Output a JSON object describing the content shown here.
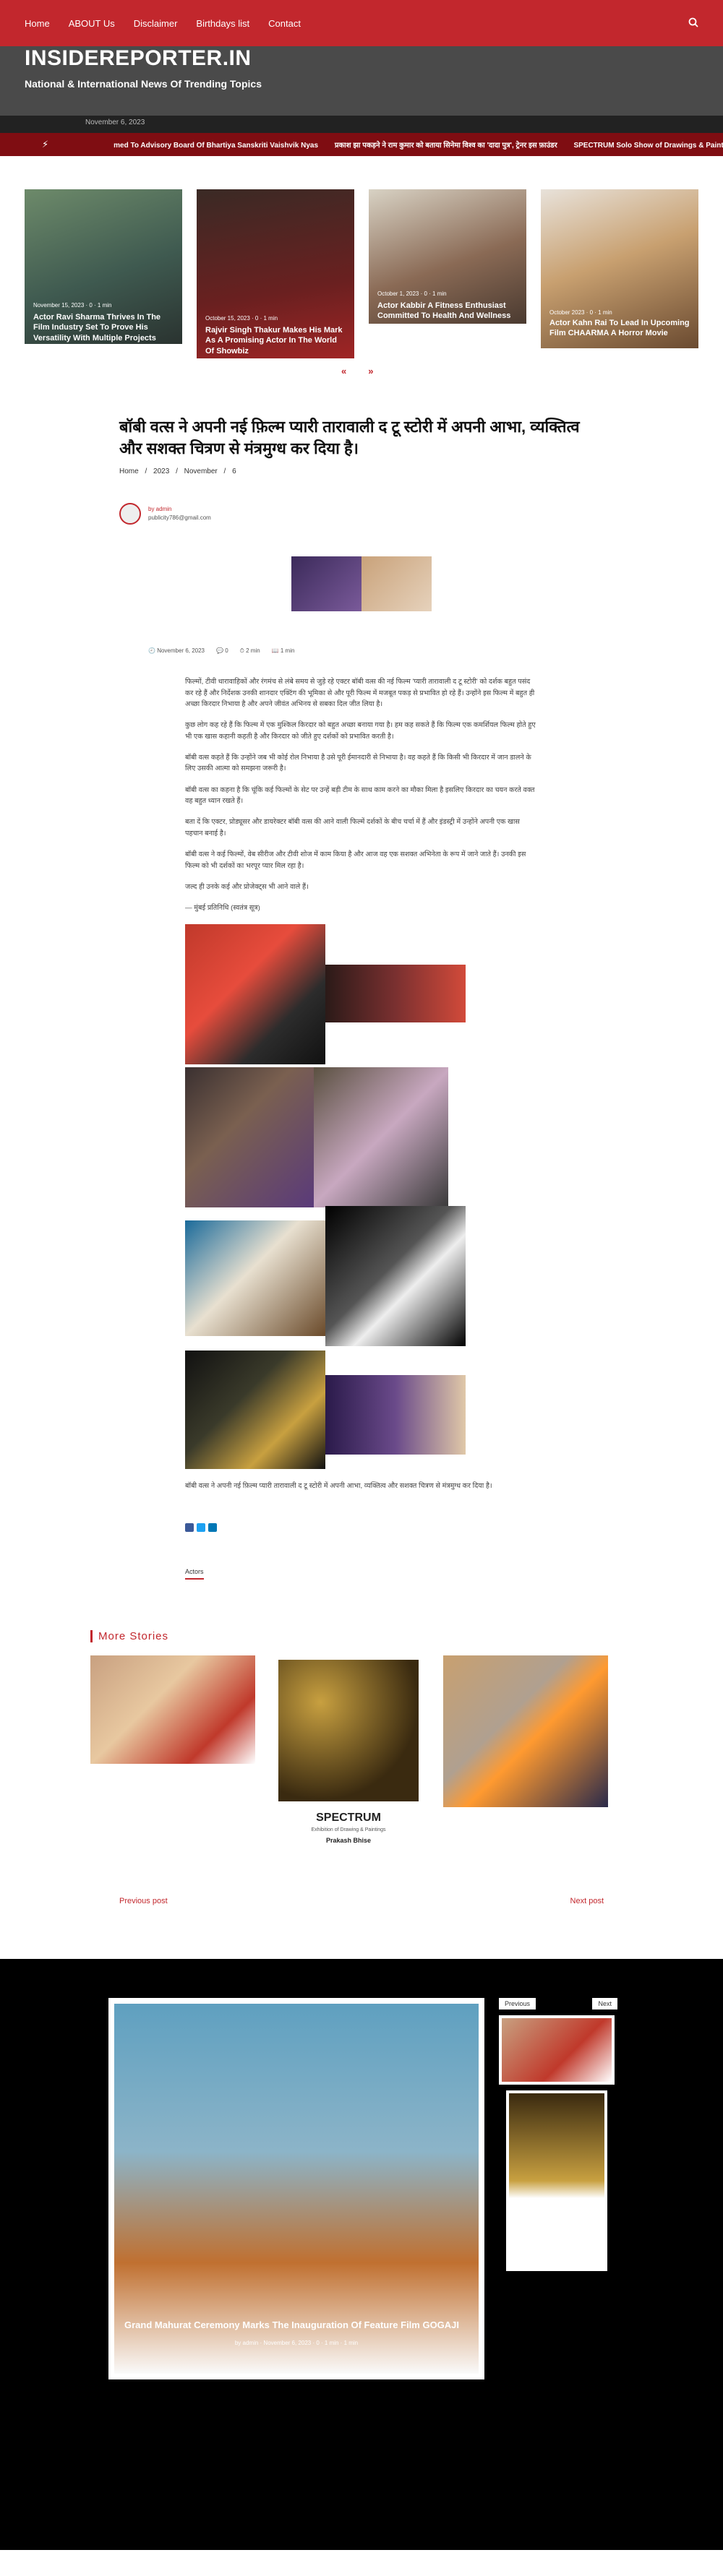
{
  "nav": {
    "items": [
      "Home",
      "ABOUT Us",
      "Disclaimer",
      "Birthdays list",
      "Contact"
    ],
    "search_icon": "search-icon"
  },
  "site": {
    "title": "INSIDEREPORTER.IN",
    "tagline": "National & International News Of Trending Topics"
  },
  "date_strip": "November 6, 2023",
  "ticker": {
    "icon": "lightning-icon",
    "items": [
      "med To Advisory Board Of Bhartiya Sanskriti Vaishvik Nyas",
      "प्रकाश झा पकड़ने ने राम कुमार को बताया सिनेमा विश्व का 'दादा पुत्र', ट्रेनर इस फ़ाउंडर",
      "SPECTRUM Solo Show of Drawings & Paintings by veteran"
    ]
  },
  "slider": {
    "slides": [
      {
        "meta": "November 15, 2023 · 0 · 1 min",
        "caption": "Actor Ravi Sharma Thrives In The Film Industry Set To Prove His Versatility With Multiple Projects"
      },
      {
        "meta": "October 15, 2023 · 0 · 1 min",
        "caption": "Rajvir Singh Thakur Makes His Mark As A Promising Actor In The World Of Showbiz"
      },
      {
        "meta": "October 1, 2023 · 0 · 1 min",
        "caption": "Actor Kabbir A Fitness Enthusiast Committed To Health And Wellness"
      },
      {
        "meta": "October 2023 · 0 · 1 min",
        "caption": "Actor Kahn Rai To Lead In Upcoming Film CHAARMA A Horror Movie"
      }
    ],
    "prev": "«",
    "next": "»"
  },
  "article": {
    "title": "बॉबी वत्स ने अपनी नई फ़िल्म प्यारी तारावाली द टू स्टोरी में अपनी आभा, व्यक्तित्व और सशक्त चित्रण से मंत्रमुग्ध कर दिया है।",
    "breadcrumb": [
      "Home",
      "/",
      "2023",
      "/",
      "November",
      "/",
      "6"
    ],
    "author_name": "by admin",
    "author_email": "publicity786@gmail.com",
    "meta": [
      "November 6, 2023",
      "0",
      "2 min",
      "1 min"
    ],
    "paragraphs": [
      "फिल्मों, टीवी धारावाहिकों और रंगमंच से लंबे समय से जुड़े रहे एक्टर बॉबी वत्स की नई फिल्म 'प्यारी तारावाली द टू स्टोरी' को दर्शक बहुत पसंद कर रहे हैं और निर्देशक उनकी शानदार एक्टिंग की भूमिका से और पूरी फिल्म में मजबूत पकड़ से प्रभावित हो रहे हैं। उन्होंने इस फिल्म में बहुत ही अच्छा किरदार निभाया है और अपने जीवंत अभिनय से सबका दिल जीत लिया है।",
      "कुछ लोग कह रहे हैं कि फिल्म में एक मुश्किल किरदार को बहुत अच्छा बनाया गया है। हम कह सकते हैं कि फिल्म एक कमर्शियल फिल्म होते हुए भी एक खास कहानी कहती है और किरदार को जीते हुए दर्शकों को प्रभावित करती है।",
      "बॉबी वत्स कहते हैं कि उन्होंने जब भी कोई रोल निभाया है उसे पूरी ईमानदारी से निभाया है। वह कहते हैं कि किसी भी किरदार में जान डालने के लिए उसकी आत्मा को समझना जरूरी है।",
      "बॉबी वत्स का कहना है कि चूंकि कई फिल्मों के सेट पर उन्हें बड़ी टीम के साथ काम करने का मौका मिला है इसलिए किरदार का चयन करते वक्त वह बहुत ध्यान रखते हैं।",
      "बता दें कि एक्टर, प्रोड्यूसर और डायरेक्टर बॉबी वत्स की आने वाली फिल्में दर्शकों के बीच चर्चा में हैं और इंडस्ट्री में उन्होंने अपनी एक खास पहचान बनाई है।",
      "बॉबी वत्स ने कई फिल्मों, वेब सीरीज और टीवी शोज में काम किया है और आज वह एक सशक्त अभिनेता के रूप में जाने जाते हैं। उनकी इस फिल्म को भी दर्शकों का भरपूर प्यार मिल रहा है।",
      "जल्द ही उनके कई और प्रोजेक्ट्स भी आने वाले हैं।",
      "— मुंबई प्रतिनिधि (स्वतंत्र सूत्र)"
    ],
    "closing": "बॉबी वत्स ने अपनी नई फ़िल्म प्यारी तारावाली द टू स्टोरी में अपनी आभा, व्यक्तित्व और सशक्त चित्रण से मंत्रमुग्ध कर दिया है।",
    "tag": "Actors"
  },
  "more": {
    "title": "More Stories",
    "spectrum": {
      "heading": "SPECTRUM",
      "sub": "Exhibition of Drawing & Paintings",
      "by": "Prakash Bhise"
    }
  },
  "pager": {
    "prev": "Previous post",
    "next": "Next post"
  },
  "footer": {
    "caption": "Grand Mahurat Ceremony Marks The Inauguration Of Feature Film GOGAJI",
    "meta": "by admin · November 6, 2023 · 0 · 1 min · 1 min",
    "previous": "Previous",
    "next": "Next"
  }
}
